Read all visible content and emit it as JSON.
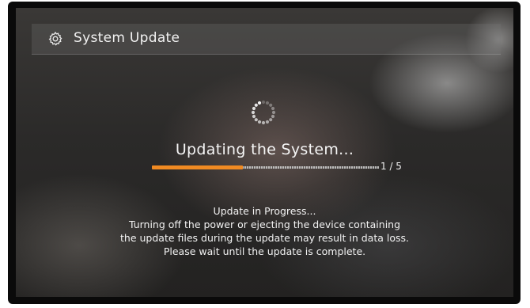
{
  "header": {
    "title": "System Update",
    "icon": "gear-icon"
  },
  "spinner": {
    "icon": "loading-spinner-icon"
  },
  "status": {
    "text": "Updating the System..."
  },
  "progress": {
    "fraction": 0.4,
    "counter": "1 / 5",
    "fill_color": "#f08a22"
  },
  "message": {
    "line1": "Update in Progress...",
    "line2": "Turning off the power or ejecting the device containing",
    "line3": "the update files during the update may result in data loss.",
    "line4": "Please wait until the update is complete."
  }
}
